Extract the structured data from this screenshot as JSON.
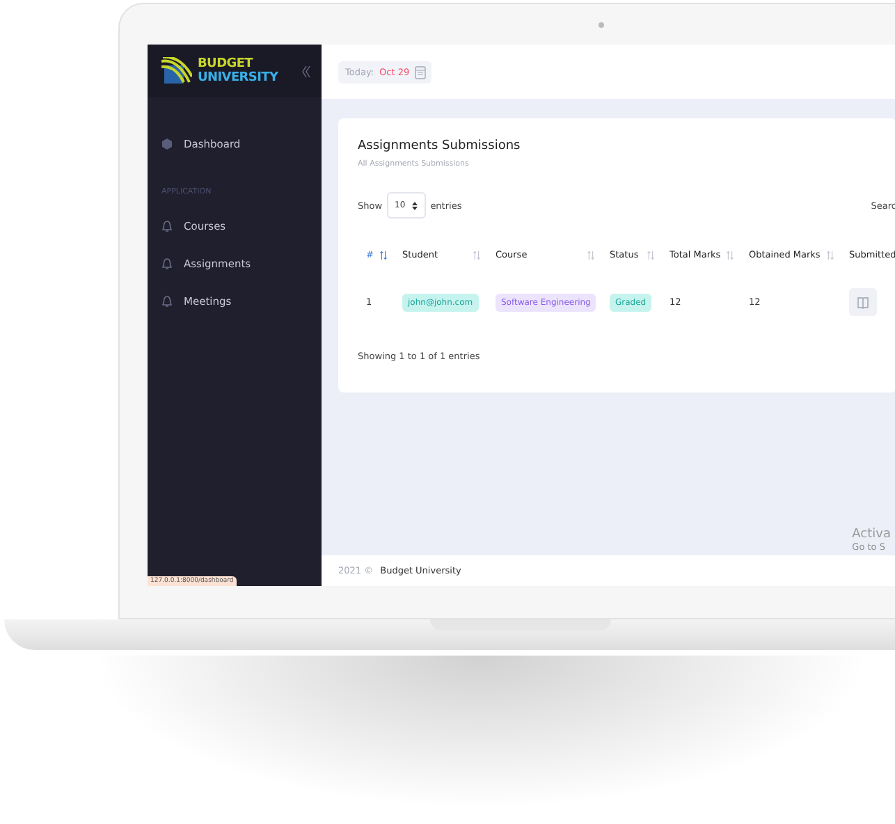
{
  "brand": {
    "line1": "BUDGET",
    "line2": "UNIVERSITY"
  },
  "sidebar": {
    "items": [
      {
        "label": "Dashboard"
      }
    ],
    "section": "APPLICATION",
    "app_items": [
      {
        "label": "Courses"
      },
      {
        "label": "Assignments"
      },
      {
        "label": "Meetings"
      }
    ]
  },
  "topbar": {
    "today_label": "Today:",
    "date": "Oct 29"
  },
  "card": {
    "title": "Assignments Submissions",
    "subtitle": "All Assignments Submissions",
    "show_label": "Show",
    "page_size": "10",
    "entries_label": "entries",
    "search_label": "Searc",
    "columns": [
      {
        "label": "#"
      },
      {
        "label": "Student"
      },
      {
        "label": "Course"
      },
      {
        "label": "Status"
      },
      {
        "label": "Total Marks"
      },
      {
        "label": "Obtained Marks"
      },
      {
        "label": "Submitted"
      }
    ],
    "rows": [
      {
        "index": "1",
        "student": "john@john.com",
        "course": "Software Engineering",
        "status": "Graded",
        "total_marks": "12",
        "obtained_marks": "12"
      }
    ],
    "info": "Showing 1 to 1 of 1 entries"
  },
  "footer": {
    "year": "2021 ©",
    "name": "Budget University"
  },
  "activation": {
    "line1": "Activa",
    "line2": "Go to S"
  },
  "status_url": "127.0.0.1:8000/dashboard"
}
